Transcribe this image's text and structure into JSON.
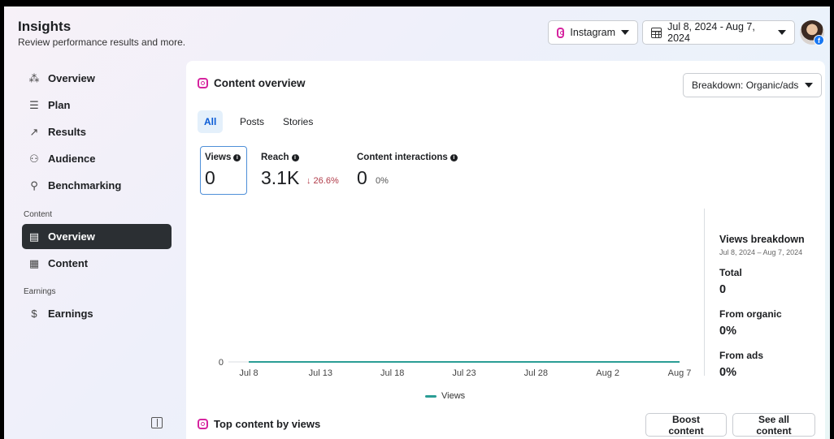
{
  "header": {
    "title": "Insights",
    "subtitle": "Review performance results and more.",
    "platform": "Instagram",
    "date_range": "Jul 8, 2024 - Aug 7, 2024",
    "badge": "f"
  },
  "sidebar": {
    "items": [
      {
        "label": "Overview",
        "icon": "network-icon"
      },
      {
        "label": "Plan",
        "icon": "list-icon"
      },
      {
        "label": "Results",
        "icon": "trend-icon"
      },
      {
        "label": "Audience",
        "icon": "people-icon"
      },
      {
        "label": "Benchmarking",
        "icon": "compare-icon"
      }
    ],
    "content_section": "Content",
    "content_items": [
      {
        "label": "Overview",
        "icon": "overview-icon",
        "active": true
      },
      {
        "label": "Content",
        "icon": "table-icon"
      }
    ],
    "earnings_section": "Earnings",
    "earnings_items": [
      {
        "label": "Earnings",
        "icon": "dollar-icon"
      }
    ]
  },
  "main": {
    "title": "Content overview",
    "breakdown": "Breakdown: Organic/ads",
    "tabs": [
      {
        "label": "All",
        "active": true
      },
      {
        "label": "Posts"
      },
      {
        "label": "Stories"
      }
    ],
    "metrics": [
      {
        "label": "Views",
        "value": "0",
        "delta": ""
      },
      {
        "label": "Reach",
        "value": "3.1K",
        "delta": "↓ 26.6%"
      },
      {
        "label": "Content interactions",
        "value": "0",
        "delta": "0%"
      }
    ],
    "breakdown_panel": {
      "title": "Views breakdown",
      "date": "Jul 8, 2024 – Aug 7, 2024",
      "total_label": "Total",
      "total_value": "0",
      "organic_label": "From organic",
      "organic_value": "0%",
      "ads_label": "From ads",
      "ads_value": "0%"
    },
    "top_content_title": "Top content by views",
    "boost_label": "Boost content",
    "see_all_label": "See all content"
  },
  "chart_data": {
    "type": "line",
    "x": [
      "Jul 8",
      "Jul 13",
      "Jul 18",
      "Jul 23",
      "Jul 28",
      "Aug 2",
      "Aug 7"
    ],
    "series": [
      {
        "name": "Views",
        "values": [
          0,
          0,
          0,
          0,
          0,
          0,
          0
        ],
        "color": "#2a9d95"
      }
    ],
    "yticks": [
      "0"
    ],
    "ylim": [
      0,
      1
    ],
    "grid": false,
    "legend": "bottom"
  }
}
